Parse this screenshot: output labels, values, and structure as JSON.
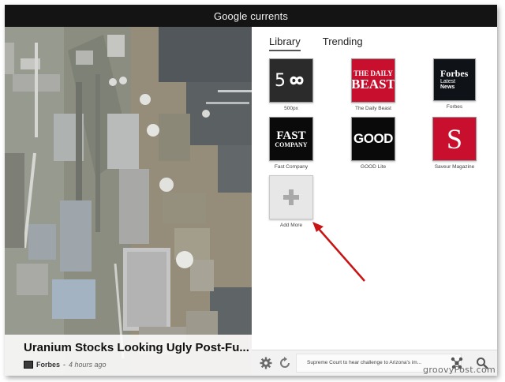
{
  "app": {
    "title_google": "Google",
    "title_currents": "currents"
  },
  "tabs": [
    {
      "label": "Library",
      "active": true
    },
    {
      "label": "Trending",
      "active": false
    }
  ],
  "feature": {
    "headline": "Uranium Stocks Looking Ugly Post-Fu...",
    "source": "Forbes",
    "time": "4 hours ago"
  },
  "library": [
    {
      "label": "500px",
      "logo_text": "5",
      "logo_icon": "infinity-icon"
    },
    {
      "label": "The Daily Beast",
      "logo_line1": "THE DAILY",
      "logo_line2": "BEAST"
    },
    {
      "label": "Forbes",
      "logo_line1": "Forbes",
      "logo_line2": "Latest",
      "logo_line3": "News"
    },
    {
      "label": "Fast Company",
      "logo_line1": "FAST",
      "logo_line2": "COMPANY"
    },
    {
      "label": "GOOD Lite",
      "logo_text": "GOOD"
    },
    {
      "label": "Saveur Magazine",
      "logo_text": "S"
    },
    {
      "label": "Add More",
      "logo_icon": "plus-icon"
    }
  ],
  "bottom": {
    "ticker": "Supreme Court to hear challenge to Arizona's im..."
  },
  "watermark": "groovyPost.com",
  "colors": {
    "topbar": "#141414",
    "daily_beast": "#c8102e",
    "saveur": "#c8102e",
    "arrow": "#c81414"
  }
}
